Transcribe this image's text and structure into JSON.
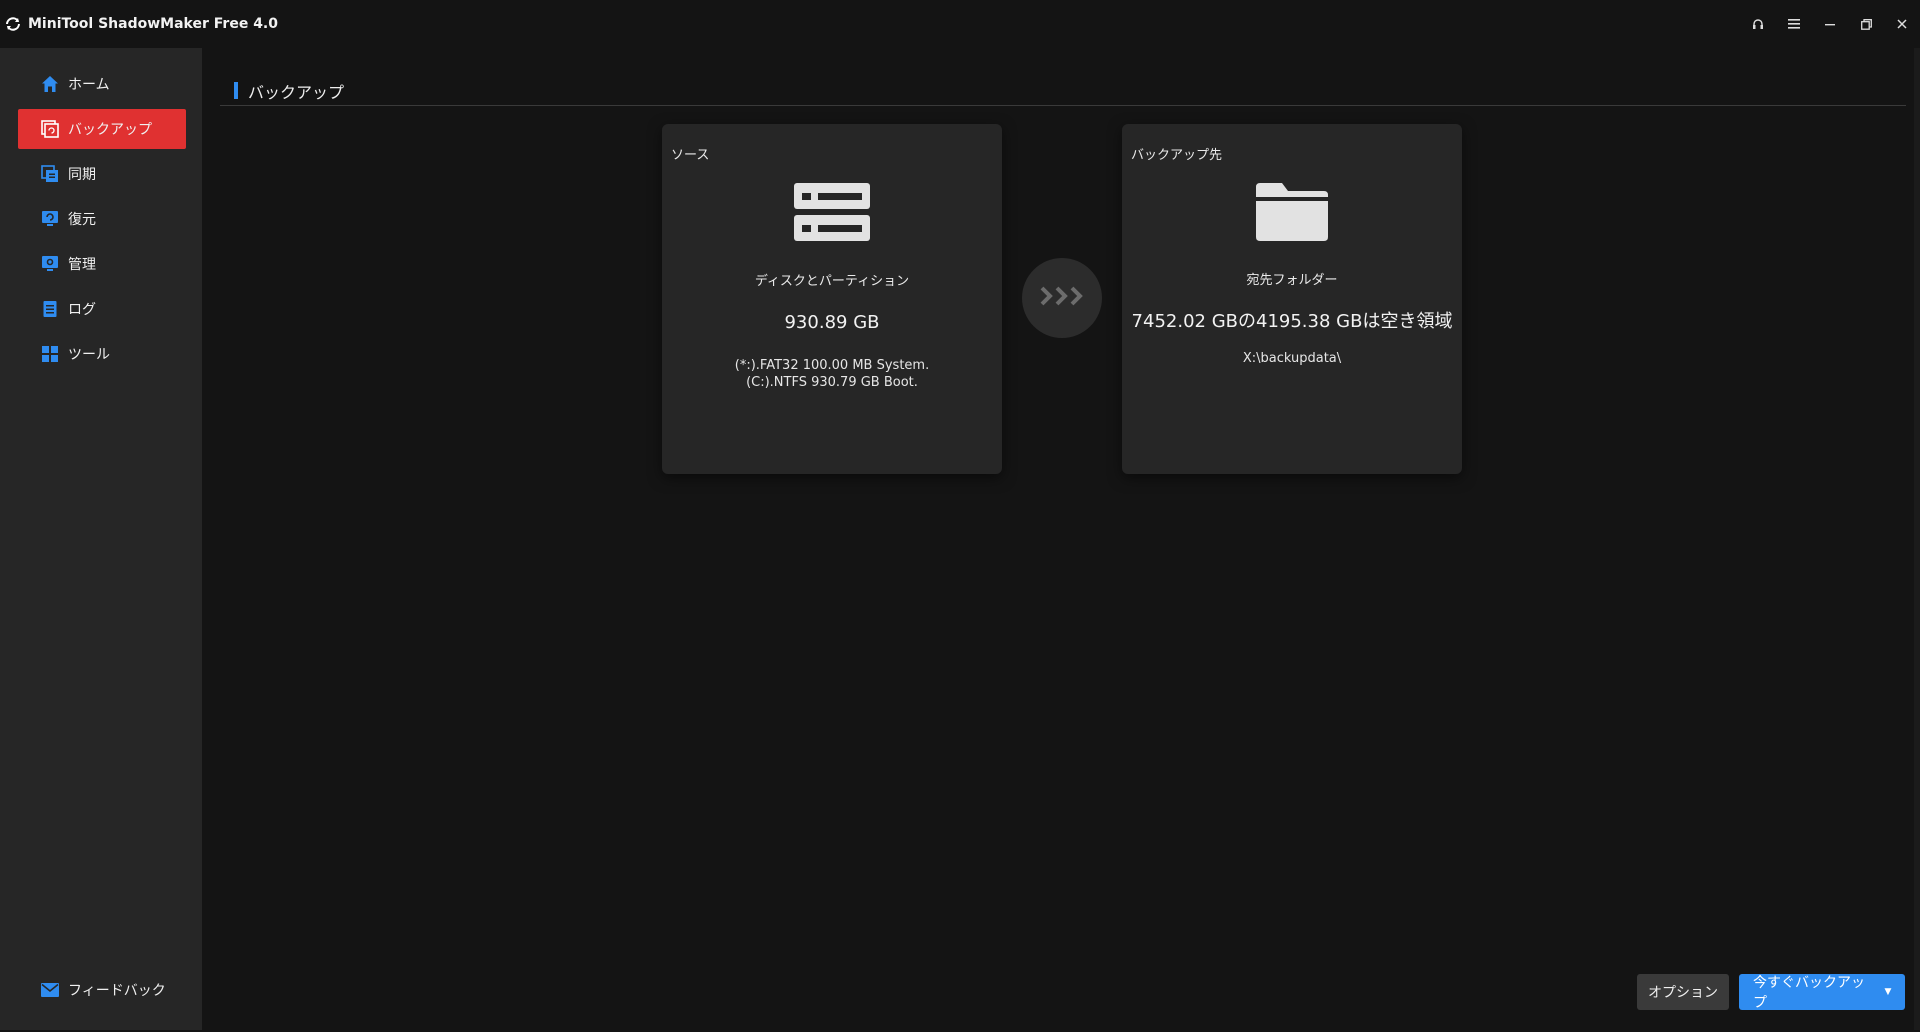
{
  "titlebar": {
    "title": "MiniTool ShadowMaker Free 4.0",
    "controls": [
      "headset-icon",
      "menu-icon",
      "minimize-icon",
      "restore-icon",
      "close-icon"
    ]
  },
  "sidebar": {
    "items": [
      {
        "label": "ホーム",
        "icon": "home-icon",
        "active": false
      },
      {
        "label": "バックアップ",
        "icon": "backup-icon",
        "active": true
      },
      {
        "label": "同期",
        "icon": "sync-icon",
        "active": false
      },
      {
        "label": "復元",
        "icon": "restore-icon",
        "active": false
      },
      {
        "label": "管理",
        "icon": "manage-icon",
        "active": false
      },
      {
        "label": "ログ",
        "icon": "log-icon",
        "active": false
      },
      {
        "label": "ツール",
        "icon": "tools-icon",
        "active": false
      }
    ],
    "feedback": {
      "label": "フィードバック",
      "icon": "mail-icon"
    }
  },
  "main": {
    "page_title": "バックアップ",
    "source": {
      "label": "ソース",
      "type": "ディスクとパーティション",
      "size": "930.89 GB",
      "detail_line1": "(*:).FAT32 100.00 MB System.",
      "detail_line2": "(C:).NTFS 930.79 GB Boot."
    },
    "destination": {
      "label": "バックアップ先",
      "type": "宛先フォルダー",
      "size": "7452.02 GBの4195.38 GBは空き領域",
      "path": "X:\\backupdata\\"
    },
    "options_label": "オプション",
    "backup_now_label": "今すぐバックアップ",
    "dropdown_glyph": "▼"
  },
  "colors": {
    "accent_blue": "#2f8cf0",
    "active_red": "#e03131",
    "sidebar_bg": "#262626",
    "main_bg": "#141414",
    "card_bg": "#262626"
  }
}
